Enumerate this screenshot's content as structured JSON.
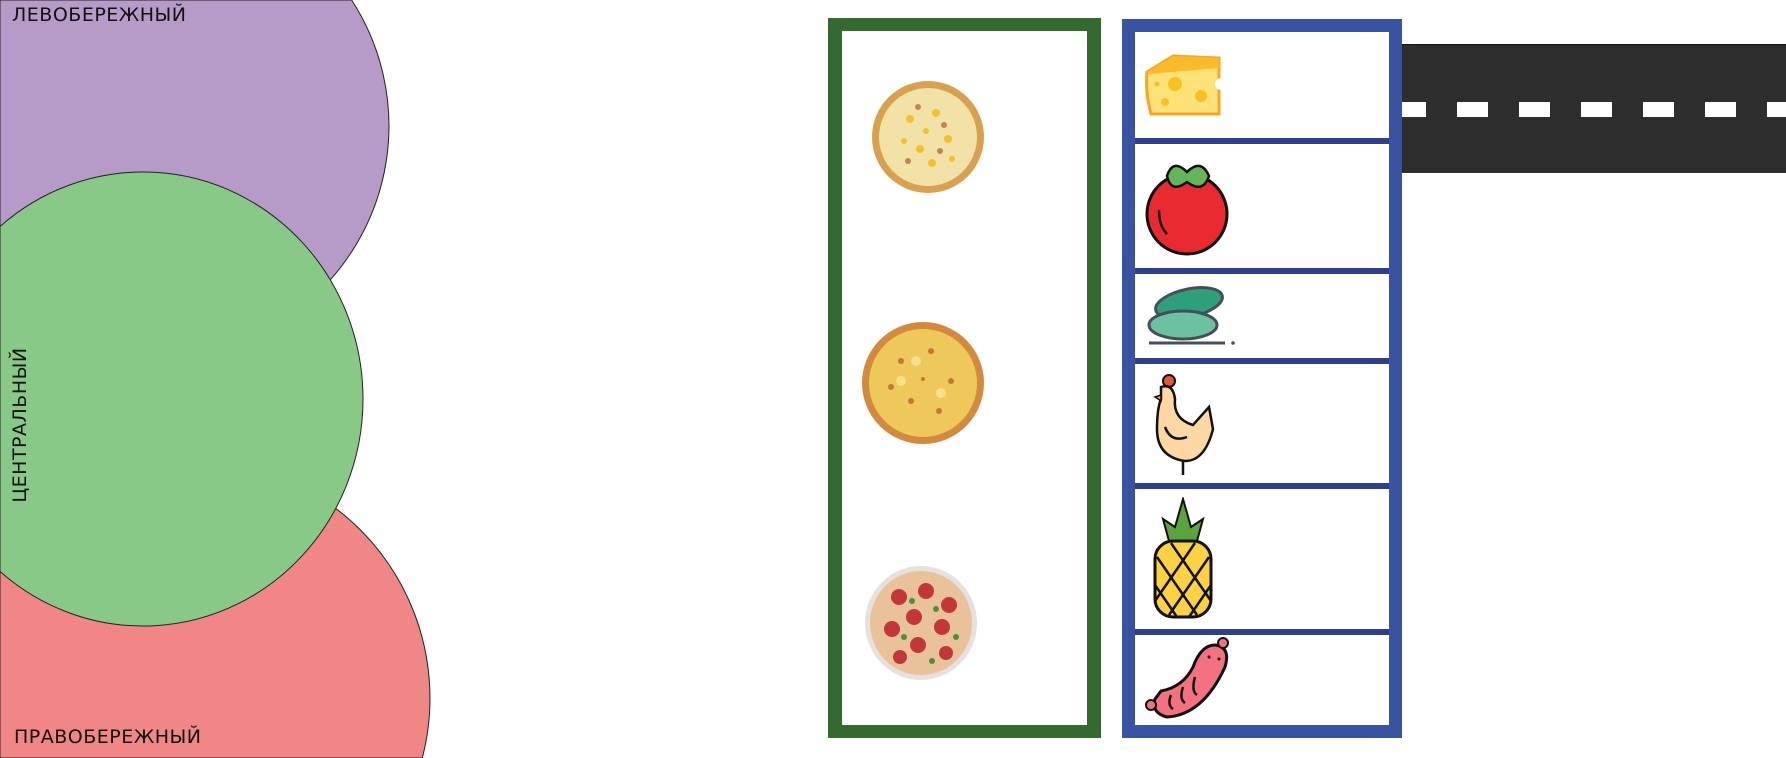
{
  "districts": {
    "left_bank": {
      "label": "ЛЕВОБЕРЕЖНЫЙ",
      "color": "#b69bc8"
    },
    "central": {
      "label": "ЦЕНТРАЛЬНЫЙ",
      "color": "#89c988"
    },
    "right_bank": {
      "label": "ПРАВОБЕРЕЖНЫЙ",
      "color": "#f08685"
    }
  },
  "pizzas": [
    "cheese-corn-pizza",
    "four-cheese-pizza",
    "pepperoni-pizza"
  ],
  "ingredients": [
    "cheese-icon",
    "tomato-icon",
    "cucumber-icon",
    "chicken-icon",
    "pineapple-icon",
    "sausage-icon"
  ],
  "colors": {
    "pizza_frame": "#34692f",
    "ingredient_frame": "#3a52a2",
    "road": "#2c2d2c"
  }
}
